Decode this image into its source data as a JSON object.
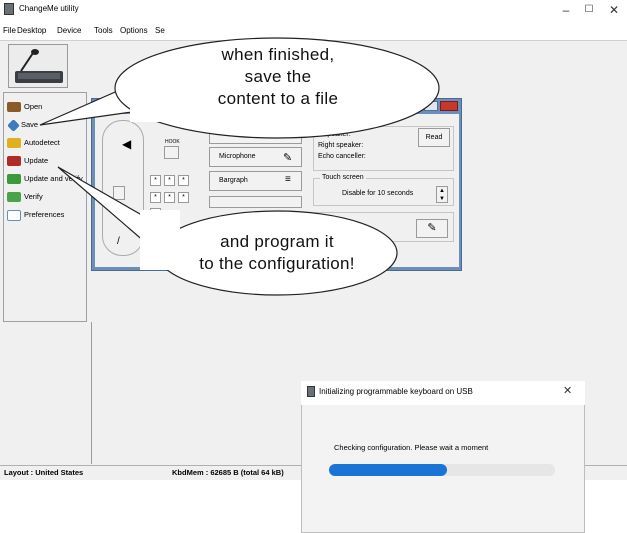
{
  "window": {
    "title": "ChangeMe utility",
    "min": "–",
    "max": "☐",
    "close": "✕"
  },
  "menu": [
    "File",
    "Desktop",
    "Device",
    "Tools",
    "Options",
    "Se"
  ],
  "sidebar": [
    {
      "label": "Open",
      "icon": "open-icon",
      "color": "#8a5a2b"
    },
    {
      "label": "Save",
      "icon": "save-icon",
      "color": "#3d7bbd"
    },
    {
      "label": "Autodetect",
      "icon": "autodetect-icon",
      "color": "#e0b020"
    },
    {
      "label": "Update",
      "icon": "update-icon",
      "color": "#b02a2a"
    },
    {
      "label": "Update and verify",
      "icon": "update-verify-icon",
      "color": "#3a9a3a"
    },
    {
      "label": "Verify",
      "icon": "verify-icon",
      "color": "#4aa34a"
    },
    {
      "label": "Preferences",
      "icon": "preferences-icon",
      "color": "#6a8fba"
    }
  ],
  "inner": {
    "hook": "HOOK",
    "mic_btn": "Microphone",
    "bargraph_btn": "Bargraph",
    "speaker1": "...speaker:",
    "speaker2": "Right speaker:",
    "echo": "Echo canceller:",
    "read_btn": "Read",
    "touch_group": "Touch screen",
    "touch_value": "Disable for 10 seconds",
    "key": "*"
  },
  "status": {
    "layout": "Layout : United States",
    "kbdmem": "KbdMem : 62685 B   (total 64 kB)"
  },
  "dialog": {
    "title": "Initializing programmable keyboard on USB",
    "close": "✕",
    "message": "Checking configuration. Please wait a moment",
    "progress": 0.52
  },
  "callouts": {
    "top": [
      "when finished,",
      "save the",
      "content to a file"
    ],
    "bottom": [
      "and program it",
      "to the configuration!"
    ]
  },
  "colors": {
    "accent": "#1a74d6",
    "inner_frame": "#6a8fba",
    "close_red": "#c9362d"
  }
}
